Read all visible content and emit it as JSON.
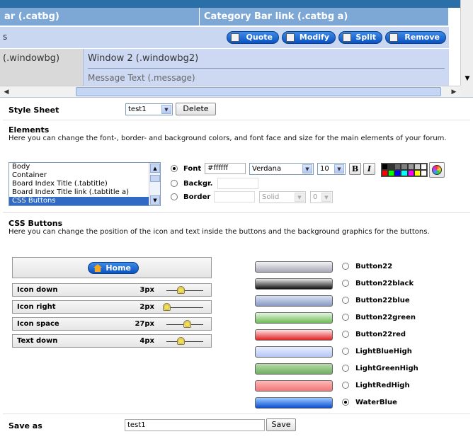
{
  "preview": {
    "catbg_left": "ar (.catbg)",
    "catbg_right": "Category Bar link (.catbg a)",
    "titlebar_text": "s",
    "buttons": [
      "Quote",
      "Modify",
      "Split",
      "Remove"
    ],
    "windowbg": "(.windowbg)",
    "windowbg2": "Window 2 (.windowbg2)",
    "message": "Message Text (.message)"
  },
  "stylesheet": {
    "label": "Style Sheet",
    "selected": "test1",
    "delete_label": "Delete"
  },
  "elements": {
    "title": "Elements",
    "description": "Here you can change the font-, border- and background colors, and font face and size for the main elements of your forum.",
    "list": [
      "Body",
      "Container",
      "Board Index Title (.tabtitle)",
      "Board Index Title link (.tabtitle a)",
      "CSS Buttons"
    ],
    "selected_item": "CSS Buttons",
    "font_label": "Font",
    "font_color": "#ffffff",
    "font_face": "Verdana",
    "font_size": "10",
    "bold_label": "B",
    "italic_label": "I",
    "background_label": "Backgr.",
    "border_label": "Border",
    "border_style": "Solid",
    "border_width": "0",
    "palette": [
      "#000000",
      "#333333",
      "#666666",
      "#808080",
      "#999999",
      "#cccccc",
      "#ffffff",
      "#ff0000",
      "#00ff00",
      "#0000ff",
      "#00ffff",
      "#ff00ff",
      "#ffff00",
      "#ffffff"
    ]
  },
  "cssbuttons": {
    "title": "CSS Buttons",
    "description": "Here you can change the position of the icon and text inside the buttons and the background graphics for the buttons.",
    "home_label": "Home",
    "controls": [
      {
        "name": "Icon down",
        "value": "3px",
        "level": 0.38
      },
      {
        "name": "Icon right",
        "value": "2px",
        "level": 0.0
      },
      {
        "name": "Icon space",
        "value": "27px",
        "level": 0.56
      },
      {
        "name": "Text down",
        "value": "4px",
        "level": 0.38
      }
    ],
    "backgrounds": [
      {
        "name": "Button22",
        "top": "#f2f2f7",
        "bottom": "#a8a8b6",
        "selected": false
      },
      {
        "name": "Button22black",
        "top": "#e6e6e6",
        "bottom": "#111111",
        "selected": false
      },
      {
        "name": "Button22blue",
        "top": "#d9e2f3",
        "bottom": "#8899c4",
        "selected": false
      },
      {
        "name": "Button22green",
        "top": "#e4f4de",
        "bottom": "#6fbb55",
        "selected": false
      },
      {
        "name": "Button22red",
        "top": "#fde2e2",
        "bottom": "#e22222",
        "selected": false
      },
      {
        "name": "LightBlueHigh",
        "top": "#e9efff",
        "bottom": "#b3c6f5",
        "selected": false
      },
      {
        "name": "LightGreenHigh",
        "top": "#b7dcaa",
        "bottom": "#6fae62",
        "selected": false
      },
      {
        "name": "LightRedHigh",
        "top": "#ffb8b8",
        "bottom": "#f07777",
        "selected": false
      },
      {
        "name": "WaterBlue",
        "top": "#9cc9ff",
        "bottom": "#0a4fd0",
        "selected": true
      }
    ]
  },
  "saveas": {
    "label": "Save as",
    "value": "test1",
    "save_label": "Save"
  }
}
